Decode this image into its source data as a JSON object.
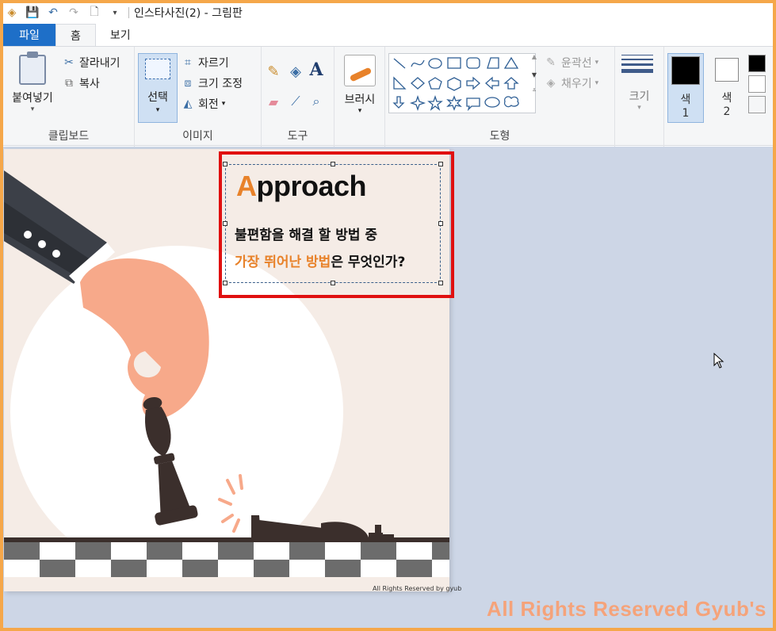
{
  "app": {
    "window_title": "인스타사진(2) - 그림판"
  },
  "tabs": [
    {
      "label": "파일"
    },
    {
      "label": "홈"
    },
    {
      "label": "보기"
    }
  ],
  "ribbon": {
    "clipboard": {
      "paste_label": "붙여넣기",
      "cut_label": "잘라내기",
      "copy_label": "복사",
      "group_label": "클립보드"
    },
    "image": {
      "select_label": "선택",
      "crop_label": "자르기",
      "resize_label": "크기 조정",
      "rotate_label": "회전",
      "group_label": "이미지"
    },
    "tools": {
      "group_label": "도구",
      "text_tool_glyph": "A"
    },
    "brushes": {
      "label": "브러시"
    },
    "shapes": {
      "outline_label": "윤곽선",
      "fill_label": "채우기",
      "group_label": "도형"
    },
    "size": {
      "label": "크기"
    },
    "colors": {
      "color1_label": "색",
      "color1_num": "1",
      "color2_label": "색",
      "color2_num": "2",
      "color1_value": "#000000",
      "color2_value": "#ffffff"
    }
  },
  "canvas": {
    "heading_first": "A",
    "heading_rest": "pproach",
    "line1": "불편함을 해결 할 방법 중",
    "line2_highlight": "가장 뛰어난 방법",
    "line2_rest": "은 무엇인가?",
    "small_watermark": "All Rights Reserved by gyub"
  },
  "overlay_watermark": "All Rights Reserved Gyub's",
  "colors": {
    "accent": "#e8822a",
    "ribbon_bg": "#f5f6f7",
    "file_tab": "#1e6fc8",
    "workspace": "#cdd6e6",
    "selection_outline": "#e01010"
  }
}
